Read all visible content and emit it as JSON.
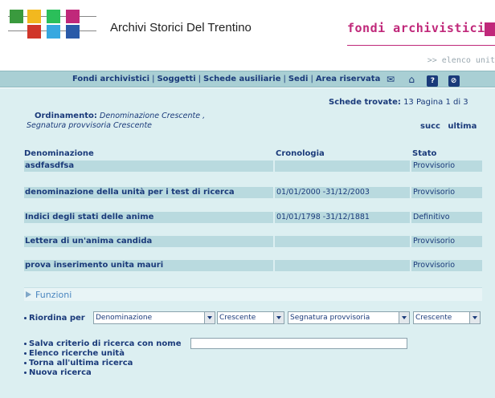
{
  "header": {
    "site_title": "Archivi Storici Del Trentino",
    "section": "fondi archivistici",
    "breadcrumb": ">> elenco unit"
  },
  "nav": {
    "links": [
      "Fondi archivistici",
      "Soggetti",
      "Schede ausiliarie",
      "Sedi",
      "Area riservata"
    ],
    "separator": "|",
    "icons": [
      "envelope-icon",
      "home-icon",
      "help-icon",
      "logout-icon"
    ],
    "help_glyph": "?"
  },
  "results": {
    "label": "Schede trovate:",
    "info": "13 Pagina 1 di 3",
    "next": "succ",
    "last": "ultima"
  },
  "ordering": {
    "label": "Ordinamento:",
    "line1": "Denominazione  Crescente ,",
    "line2": "Segnatura provvisoria  Crescente"
  },
  "table": {
    "headers": [
      "Denominazione",
      "Cronologia",
      "Stato"
    ],
    "rows": [
      {
        "denominazione": "asdfasdfsa",
        "cronologia": "",
        "stato": "Provvisorio"
      },
      {
        "denominazione": "denominazione della unità per i test di ricerca",
        "cronologia": "01/01/2000 -31/12/2003",
        "stato": "Provvisorio"
      },
      {
        "denominazione": "Indici degli stati delle anime",
        "cronologia": "01/01/1798 -31/12/1881",
        "stato": "Definitivo"
      },
      {
        "denominazione": "Lettera di un'anima candida",
        "cronologia": "",
        "stato": "Provvisorio"
      },
      {
        "denominazione": "prova inserimento unita mauri",
        "cronologia": "",
        "stato": "Provvisorio"
      }
    ]
  },
  "functions": {
    "title": "Funzioni",
    "reorder_label": "Riordina per",
    "selects": [
      "Denominazione",
      "Crescente",
      "Segnatura provvisoria",
      "Crescente"
    ],
    "actions": [
      "Salva criterio di ricerca con nome",
      "Elenco ricerche unità",
      "Torna all'ultima ricerca",
      "Nuova ricerca"
    ],
    "save_value": ""
  },
  "colors": {
    "accent": "#c0287a",
    "nav_bg": "#a9cfd4",
    "content_bg": "#dceff1",
    "text": "#1a3a7a"
  }
}
